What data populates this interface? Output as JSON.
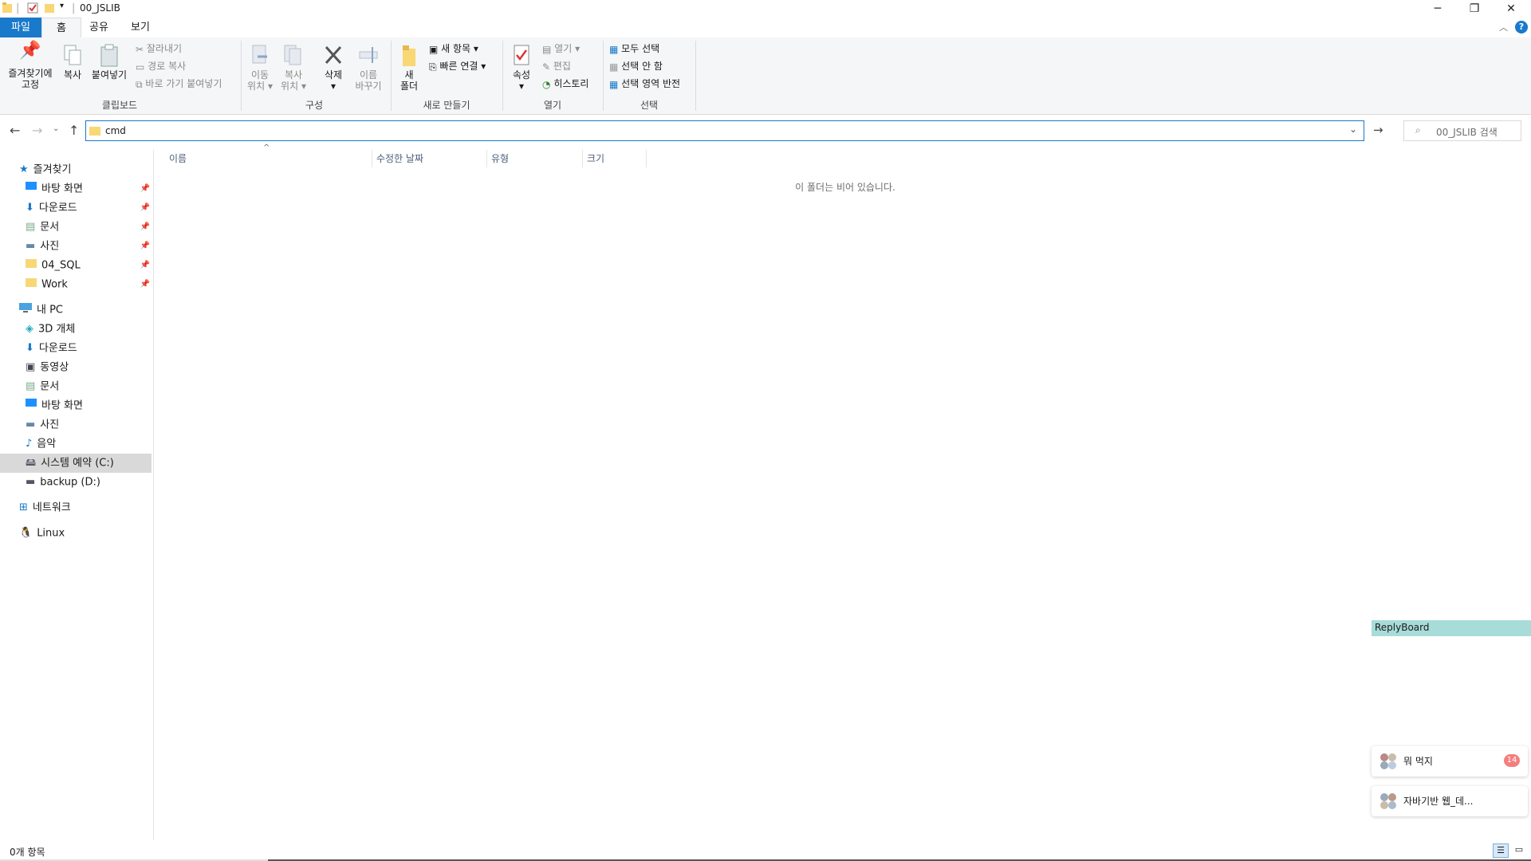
{
  "window": {
    "title": "00_JSLIB"
  },
  "tabs": [
    "파일",
    "홈",
    "공유",
    "보기"
  ],
  "ribbon": {
    "clipboard": {
      "pin_label_1": "즐겨찾기에",
      "pin_label_2": "고정",
      "copy": "복사",
      "paste": "붙여넣기",
      "cut": "잘라내기",
      "copy_path": "경로 복사",
      "paste_shortcut": "바로 가기 붙여넣기",
      "group": "클립보드"
    },
    "organize": {
      "move_1": "이동",
      "move_2": "위치",
      "copy_1": "복사",
      "copy_2": "위치",
      "delete": "삭제",
      "rename_1": "이름",
      "rename_2": "바꾸기",
      "group": "구성"
    },
    "new": {
      "new_folder_1": "새",
      "new_folder_2": "폴더",
      "new_item": "새 항목",
      "easy_access": "빠른 연결",
      "group": "새로 만들기"
    },
    "open": {
      "properties": "속성",
      "open": "열기",
      "edit": "편집",
      "history": "히스토리",
      "group": "열기"
    },
    "select": {
      "select_all": "모두 선택",
      "select_none": "선택 안 함",
      "invert": "선택 영역 반전",
      "group": "선택"
    }
  },
  "address": {
    "value": "cmd",
    "search_placeholder": "00_JSLIB 검색"
  },
  "nav": {
    "quick_access": "즐겨찾기",
    "quick_items": [
      "바탕 화면",
      "다운로드",
      "문서",
      "사진",
      "04_SQL",
      "Work"
    ],
    "this_pc": "내 PC",
    "pc_items": [
      "3D 개체",
      "다운로드",
      "동영상",
      "문서",
      "바탕 화면",
      "사진",
      "음악",
      "시스템 예약 (C:)",
      "backup (D:)"
    ],
    "network": "네트워크",
    "linux": "Linux"
  },
  "columns": [
    "이름",
    "수정한 날짜",
    "유형",
    "크기"
  ],
  "empty_message": "이 폴더는 비어 있습니다.",
  "status": {
    "count": "0개 항목"
  },
  "overlay": {
    "reply_board": "ReplyBoard",
    "chat1": "뭐 먹지",
    "chat1_badge": "14",
    "chat2": "자바기반 웹_데..."
  },
  "colors": {
    "accent": "#1979ca",
    "selected": "#d9d9d9",
    "reply": "#a7dcd9",
    "badge": "#f47e7e"
  }
}
